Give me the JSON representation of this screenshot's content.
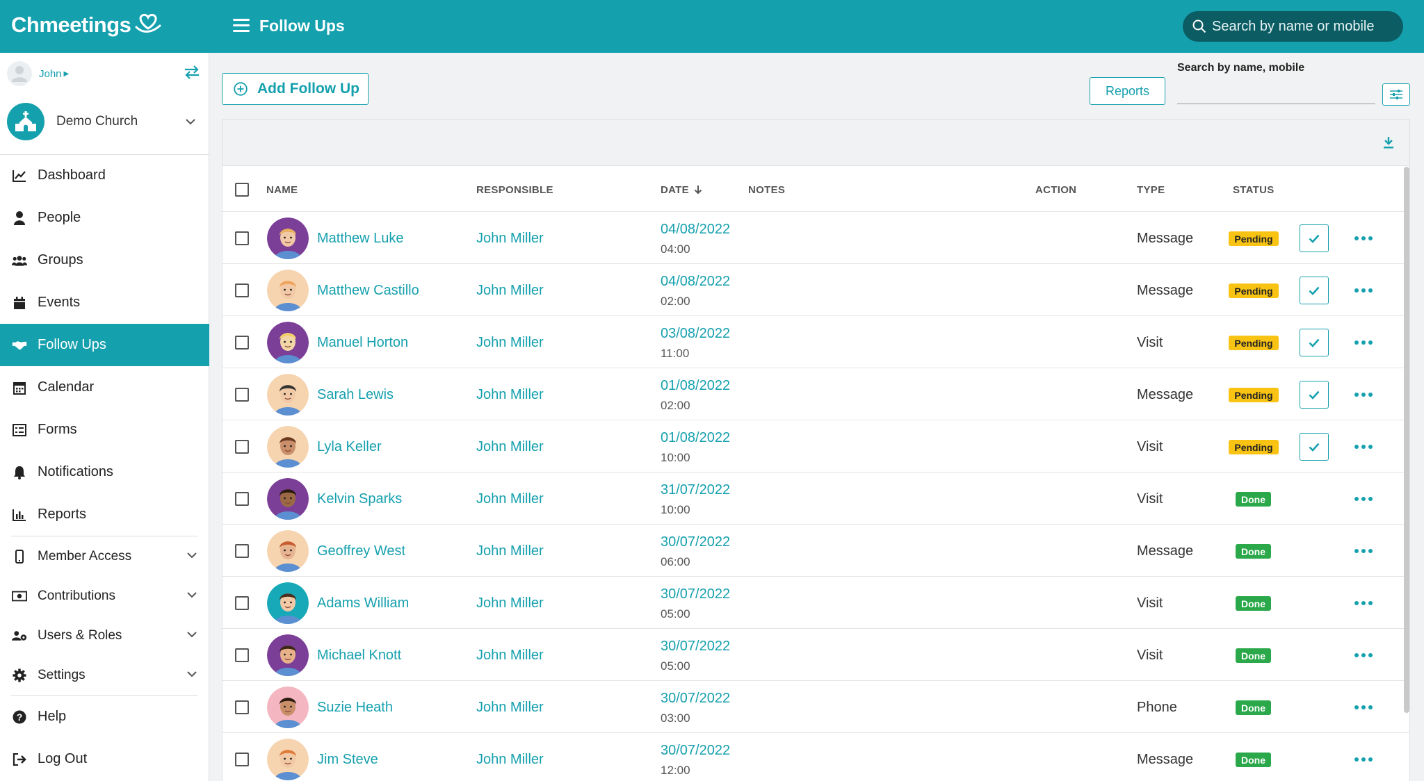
{
  "app": {
    "name": "Chmeetings"
  },
  "header": {
    "title": "Follow Ups",
    "search_placeholder": "Search by name or mobile"
  },
  "sidebar": {
    "user": "John",
    "church": "Demo Church",
    "items": [
      {
        "label": "Dashboard",
        "icon": "chart-line-icon"
      },
      {
        "label": "People",
        "icon": "person-icon"
      },
      {
        "label": "Groups",
        "icon": "users-icon"
      },
      {
        "label": "Events",
        "icon": "calendar-icon"
      },
      {
        "label": "Follow Ups",
        "icon": "handshake-icon",
        "active": true
      },
      {
        "label": "Calendar",
        "icon": "calendar-grid-icon"
      },
      {
        "label": "Forms",
        "icon": "list-icon"
      },
      {
        "label": "Notifications",
        "icon": "bell-icon"
      },
      {
        "label": "Reports",
        "icon": "bar-chart-icon"
      },
      {
        "label": "Member Access",
        "icon": "mobile-icon"
      },
      {
        "label": "Contributions",
        "icon": "money-icon"
      },
      {
        "label": "Users & Roles",
        "icon": "users-cog-icon"
      },
      {
        "label": "Settings",
        "icon": "gear-icon"
      },
      {
        "label": "Help",
        "icon": "question-icon"
      },
      {
        "label": "Log Out",
        "icon": "sign-out-icon"
      }
    ]
  },
  "toolbar": {
    "add_label": "Add Follow Up",
    "reports_label": "Reports",
    "search_label": "Search by name, mobile"
  },
  "table": {
    "columns": {
      "name": "NAME",
      "responsible": "RESPONSIBLE",
      "date": "DATE",
      "notes": "NOTES",
      "action": "ACTION",
      "type": "TYPE",
      "status": "STATUS"
    },
    "rows": [
      {
        "name": "Matthew Luke",
        "responsible": "John Miller",
        "date": "04/08/2022",
        "time": "04:00",
        "type": "Message",
        "status": "Pending"
      },
      {
        "name": "Matthew Castillo",
        "responsible": "John Miller",
        "date": "04/08/2022",
        "time": "02:00",
        "type": "Message",
        "status": "Pending"
      },
      {
        "name": "Manuel Horton",
        "responsible": "John Miller",
        "date": "03/08/2022",
        "time": "11:00",
        "type": "Visit",
        "status": "Pending"
      },
      {
        "name": "Sarah Lewis",
        "responsible": "John Miller",
        "date": "01/08/2022",
        "time": "02:00",
        "type": "Message",
        "status": "Pending"
      },
      {
        "name": "Lyla Keller",
        "responsible": "John Miller",
        "date": "01/08/2022",
        "time": "10:00",
        "type": "Visit",
        "status": "Pending"
      },
      {
        "name": "Kelvin Sparks",
        "responsible": "John Miller",
        "date": "31/07/2022",
        "time": "10:00",
        "type": "Visit",
        "status": "Done"
      },
      {
        "name": "Geoffrey West",
        "responsible": "John Miller",
        "date": "30/07/2022",
        "time": "06:00",
        "type": "Message",
        "status": "Done"
      },
      {
        "name": "Adams William",
        "responsible": "John Miller",
        "date": "30/07/2022",
        "time": "05:00",
        "type": "Visit",
        "status": "Done"
      },
      {
        "name": "Michael Knott",
        "responsible": "John Miller",
        "date": "30/07/2022",
        "time": "05:00",
        "type": "Visit",
        "status": "Done"
      },
      {
        "name": "Suzie Heath",
        "responsible": "John Miller",
        "date": "30/07/2022",
        "time": "03:00",
        "type": "Phone",
        "status": "Done"
      },
      {
        "name": "Jim Steve",
        "responsible": "John Miller",
        "date": "30/07/2022",
        "time": "12:00",
        "type": "Message",
        "status": "Done"
      }
    ]
  },
  "colors": {
    "brand": "#15a0ae",
    "pending": "#f9c314",
    "done": "#2ba84a"
  }
}
